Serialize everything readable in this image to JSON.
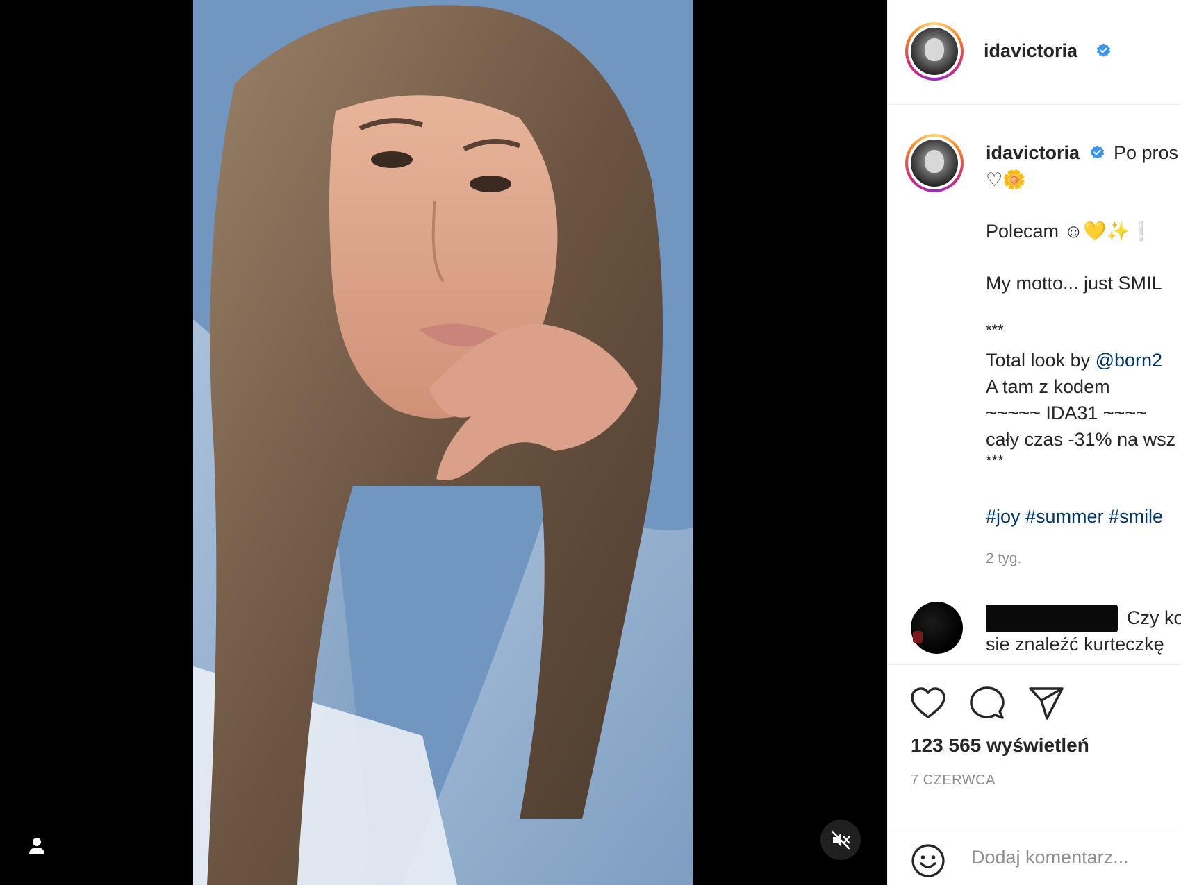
{
  "post": {
    "username": "idavictoria",
    "views_label": "123 565 wyświetleń",
    "date": "7 CZERWCA"
  },
  "caption": {
    "username": "idavictoria",
    "line1": "Po pros",
    "line2_emoji": "♡🌼",
    "line3": "Polecam ☺💛✨❕",
    "line4": "My motto... just SMIL",
    "line5": "***",
    "line6_prefix": "Total look by ",
    "line6_mention": "@born2",
    "line7": "A tam z kodem",
    "line8": "~~~~~ IDA31 ~~~~",
    "line9": "cały czas -31% na wsz",
    "line10": "***",
    "hashtags": "#joy #summer #smile",
    "age": "2 tyg."
  },
  "comment": {
    "text1": "Czy ko",
    "text2": "sie znaleźć kurteczkę"
  },
  "add_comment": {
    "placeholder": "Dodaj komentarz..."
  },
  "icons": {
    "user_tag": "user-icon",
    "mute": "speaker-muted-icon",
    "like": "heart-icon",
    "comment": "comment-bubble-icon",
    "share": "paper-plane-icon",
    "emoji": "smiley-icon",
    "verified": "verified-badge-icon"
  },
  "colors": {
    "link": "#00376b",
    "verified": "#3897f0",
    "muted_text": "#8e8e8e",
    "text": "#262626"
  }
}
